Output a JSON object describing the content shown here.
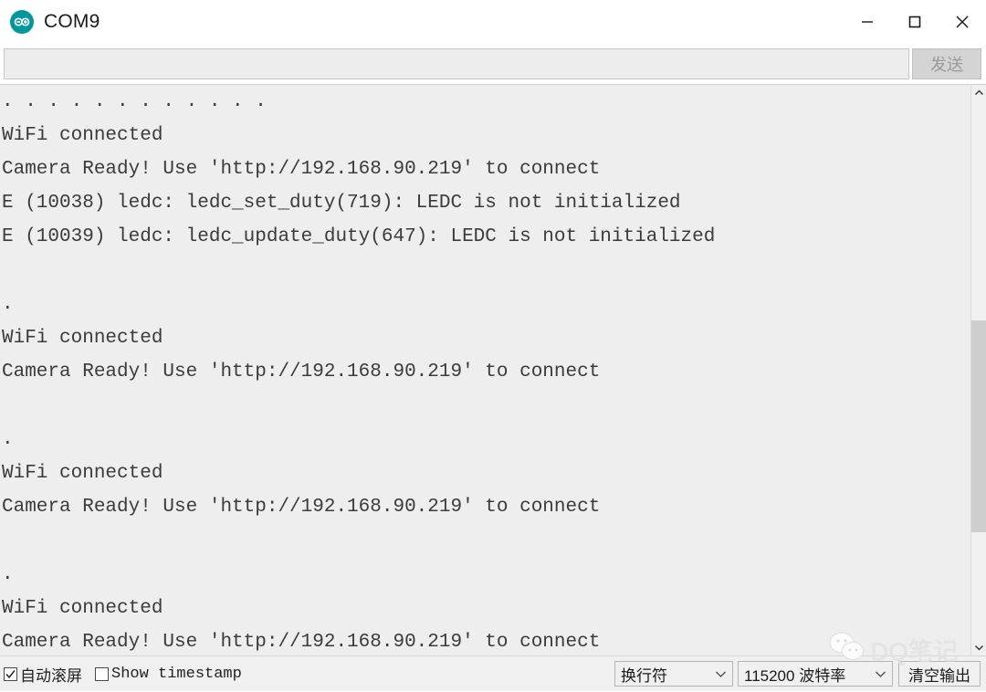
{
  "window": {
    "title": "COM9",
    "app_icon": "arduino-infinity-icon",
    "accent_color": "#00979d",
    "controls": {
      "minimize": "minimize-icon",
      "maximize": "maximize-icon",
      "close": "close-icon"
    }
  },
  "send_bar": {
    "input_value": "",
    "input_placeholder": "",
    "send_label": "发送",
    "send_disabled": true
  },
  "console": {
    "background": "#eeeeee",
    "text_color": "#3b3b3b",
    "lines": [
      ". . . . . . . . . . . .",
      "WiFi connected",
      "Camera Ready! Use 'http://192.168.90.219' to connect",
      "E (10038) ledc: ledc_set_duty(719): LEDC is not initialized",
      "E (10039) ledc: ledc_update_duty(647): LEDC is not initialized",
      "",
      ".",
      "WiFi connected",
      "Camera Ready! Use 'http://192.168.90.219' to connect",
      "",
      ".",
      "WiFi connected",
      "Camera Ready! Use 'http://192.168.90.219' to connect",
      "",
      ".",
      "WiFi connected",
      "Camera Ready! Use 'http://192.168.90.219' to connect"
    ]
  },
  "scrollbar": {
    "up_arrow": "chevron-up-icon",
    "down_arrow": "chevron-down-icon"
  },
  "status_bar": {
    "autoscroll_label": "自动滚屏",
    "autoscroll_checked": true,
    "timestamp_label": "Show timestamp",
    "timestamp_checked": false,
    "line_ending_value": "换行符",
    "baud_value": "115200 波特率",
    "clear_label": "清空输出"
  },
  "watermark": {
    "icon": "wechat-icon",
    "text": "DQ笔记"
  }
}
